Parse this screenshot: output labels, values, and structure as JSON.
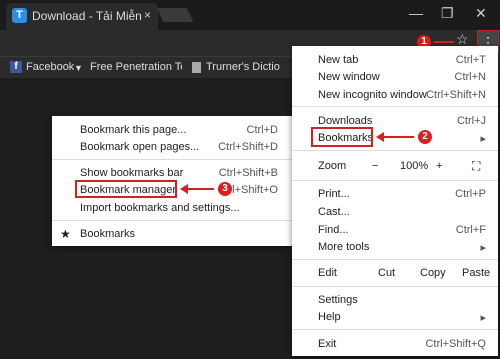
{
  "window": {
    "tab_title": "Download - Tải Miễn Phí",
    "tab_favicon": "T",
    "tab_close": "×",
    "minimize": "—",
    "restore": "❐",
    "close": "✕"
  },
  "toolbar": {
    "star_icon": "☆",
    "menu_icon": "⋮"
  },
  "bookmarks_bar": {
    "items": [
      {
        "label": "Facebook",
        "icon": "facebook-icon"
      },
      {
        "label": "Free Penetration Testi",
        "icon": "bookmark-icon"
      },
      {
        "label": "Trurner's Dictio",
        "icon": "page-icon"
      }
    ]
  },
  "main_menu": {
    "items": [
      {
        "label": "New tab",
        "shortcut": "Ctrl+T"
      },
      {
        "label": "New window",
        "shortcut": "Ctrl+N"
      },
      {
        "label": "New incognito window",
        "shortcut": "Ctrl+Shift+N"
      },
      {
        "label": "Downloads",
        "shortcut": "Ctrl+J"
      },
      {
        "label": "Bookmarks",
        "shortcut": "▸"
      },
      {
        "label": "Print...",
        "shortcut": "Ctrl+P"
      },
      {
        "label": "Cast...",
        "shortcut": ""
      },
      {
        "label": "Find...",
        "shortcut": "Ctrl+F"
      },
      {
        "label": "More tools",
        "shortcut": "▸"
      },
      {
        "label": "Settings",
        "shortcut": ""
      },
      {
        "label": "Help",
        "shortcut": "▸"
      },
      {
        "label": "Exit",
        "shortcut": "Ctrl+Shift+Q"
      }
    ],
    "zoom": {
      "label": "Zoom",
      "minus": "−",
      "value": "100%",
      "plus": "+",
      "fullscreen": "⛶"
    },
    "edit": {
      "label": "Edit",
      "cut": "Cut",
      "copy": "Copy",
      "paste": "Paste"
    }
  },
  "bookmarks_submenu": {
    "items": [
      {
        "label": "Bookmark this page...",
        "shortcut": "Ctrl+D"
      },
      {
        "label": "Bookmark open pages...",
        "shortcut": "Ctrl+Shift+D"
      },
      {
        "label": "Show bookmarks bar",
        "shortcut": "Ctrl+Shift+B"
      },
      {
        "label": "Bookmark manager",
        "shortcut": "Ctrl+Shift+O"
      },
      {
        "label": "Import bookmarks and settings...",
        "shortcut": ""
      },
      {
        "label": "Bookmarks",
        "shortcut": ""
      }
    ]
  },
  "annotations": {
    "step1": "1",
    "step2": "2",
    "step3": "3",
    "color": "#d42020"
  }
}
